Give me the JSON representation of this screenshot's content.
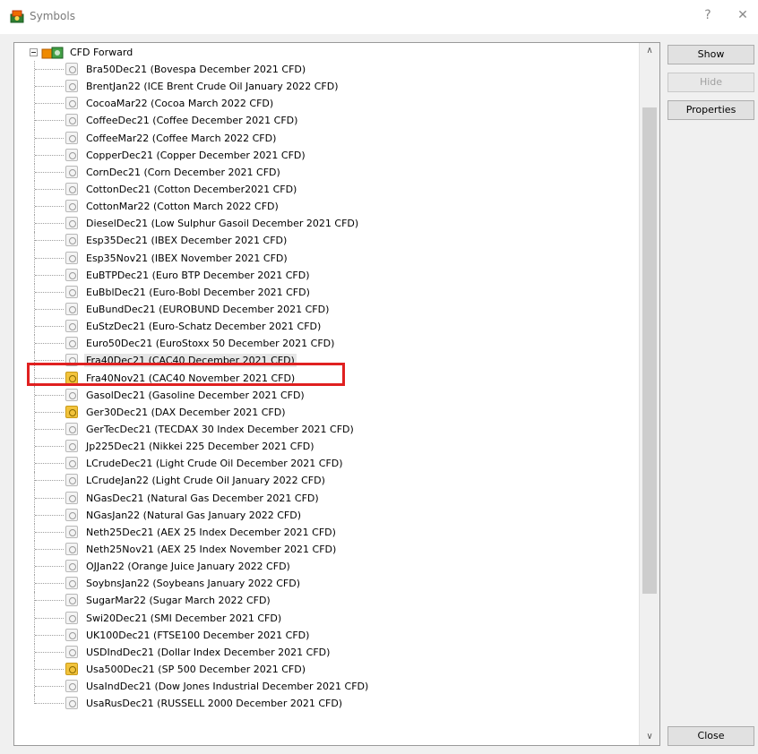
{
  "window": {
    "title": "Symbols",
    "help_label": "?",
    "close_label": "✕"
  },
  "tree": {
    "root_label": "CFD Forward",
    "items": [
      {
        "label": "Bra50Dec21  (Bovespa December 2021 CFD)",
        "icon": "gray"
      },
      {
        "label": "BrentJan22  (ICE Brent Crude Oil January 2022 CFD)",
        "icon": "gray"
      },
      {
        "label": "CocoaMar22  (Cocoa March 2022 CFD)",
        "icon": "gray"
      },
      {
        "label": "CoffeeDec21  (Coffee December 2021 CFD)",
        "icon": "gray"
      },
      {
        "label": "CoffeeMar22  (Coffee March 2022 CFD)",
        "icon": "gray"
      },
      {
        "label": "CopperDec21  (Copper December 2021 CFD)",
        "icon": "gray"
      },
      {
        "label": "CornDec21  (Corn December 2021 CFD)",
        "icon": "gray"
      },
      {
        "label": "CottonDec21  (Cotton December2021 CFD)",
        "icon": "gray"
      },
      {
        "label": "CottonMar22  (Cotton March 2022 CFD)",
        "icon": "gray"
      },
      {
        "label": "DieselDec21  (Low Sulphur Gasoil December 2021 CFD)",
        "icon": "gray"
      },
      {
        "label": "Esp35Dec21  (IBEX December 2021 CFD)",
        "icon": "gray"
      },
      {
        "label": "Esp35Nov21  (IBEX November 2021 CFD)",
        "icon": "gray"
      },
      {
        "label": "EuBTPDec21  (Euro BTP December 2021 CFD)",
        "icon": "gray"
      },
      {
        "label": "EuBblDec21  (Euro-Bobl December 2021 CFD)",
        "icon": "gray"
      },
      {
        "label": "EuBundDec21  (EUROBUND December 2021  CFD)",
        "icon": "gray"
      },
      {
        "label": "EuStzDec21  (Euro-Schatz December 2021 CFD)",
        "icon": "gray"
      },
      {
        "label": "Euro50Dec21  (EuroStoxx 50 December 2021 CFD)",
        "icon": "gray"
      },
      {
        "label": "Fra40Dec21  (CAC40 December 2021 CFD)",
        "icon": "gray",
        "selected": true
      },
      {
        "label": "Fra40Nov21  (CAC40 November 2021 CFD)",
        "icon": "gold"
      },
      {
        "label": "GasolDec21  (Gasoline December 2021 CFD)",
        "icon": "gray"
      },
      {
        "label": "Ger30Dec21  (DAX December 2021 CFD)",
        "icon": "gold"
      },
      {
        "label": "GerTecDec21  (TECDAX 30 Index December 2021 CFD)",
        "icon": "gray"
      },
      {
        "label": "Jp225Dec21  (Nikkei 225 December 2021 CFD)",
        "icon": "gray"
      },
      {
        "label": "LCrudeDec21  (Light Crude Oil December 2021 CFD)",
        "icon": "gray"
      },
      {
        "label": "LCrudeJan22  (Light Crude Oil January 2022 CFD)",
        "icon": "gray"
      },
      {
        "label": "NGasDec21  (Natural Gas December 2021 CFD)",
        "icon": "gray"
      },
      {
        "label": "NGasJan22  (Natural Gas January 2022 CFD)",
        "icon": "gray"
      },
      {
        "label": "Neth25Dec21  (AEX 25 Index December 2021 CFD)",
        "icon": "gray"
      },
      {
        "label": "Neth25Nov21  (AEX 25 Index November 2021 CFD)",
        "icon": "gray"
      },
      {
        "label": "OJJan22  (Orange Juice January 2022 CFD)",
        "icon": "gray"
      },
      {
        "label": "SoybnsJan22  (Soybeans January 2022 CFD)",
        "icon": "gray"
      },
      {
        "label": "SugarMar22  (Sugar March 2022 CFD)",
        "icon": "gray"
      },
      {
        "label": "Swi20Dec21  (SMI December 2021 CFD)",
        "icon": "gray"
      },
      {
        "label": "UK100Dec21  (FTSE100 December 2021 CFD)",
        "icon": "gray"
      },
      {
        "label": "USDIndDec21  (Dollar Index December 2021 CFD)",
        "icon": "gray"
      },
      {
        "label": "Usa500Dec21  (SP 500 December 2021 CFD)",
        "icon": "gold"
      },
      {
        "label": "UsaIndDec21  (Dow Jones Industrial December 2021 CFD)",
        "icon": "gray"
      },
      {
        "label": "UsaRusDec21  (RUSSELL 2000 December 2021 CFD)",
        "icon": "gray"
      }
    ]
  },
  "buttons": {
    "show": "Show",
    "hide": "Hide",
    "properties": "Properties",
    "close": "Close"
  },
  "scroll": {
    "up_glyph": "∧",
    "down_glyph": "∨"
  },
  "colors": {
    "highlight": "#e02020",
    "gold_icon": "#f2c33c"
  }
}
